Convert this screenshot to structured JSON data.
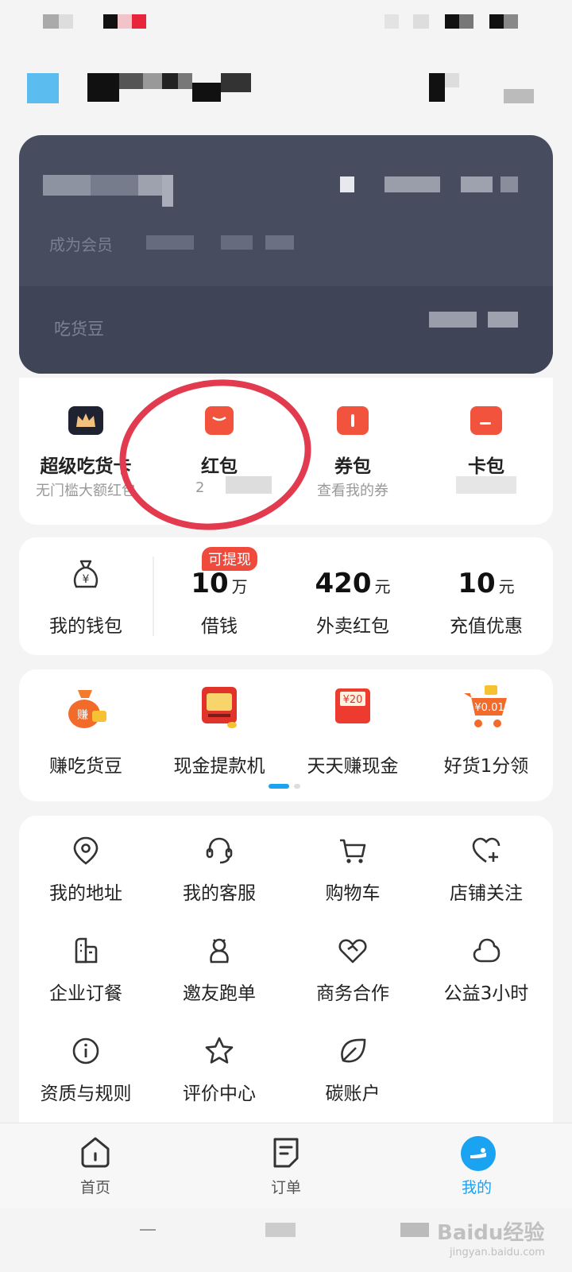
{
  "member_card": {
    "subtitle": "成为会员",
    "bean_label": "吃货豆"
  },
  "assets": [
    {
      "label": "超级吃货卡",
      "sub": "无门槛大额红包",
      "icon": "crown-card-icon",
      "color": "#1f2230"
    },
    {
      "label": "红包",
      "sub": "2",
      "icon": "red-envelope-icon",
      "color": "#f2533c"
    },
    {
      "label": "券包",
      "sub": "查看我的券",
      "icon": "coupon-icon",
      "color": "#f2533c"
    },
    {
      "label": "卡包",
      "sub": "",
      "icon": "card-wallet-icon",
      "color": "#f2533c"
    }
  ],
  "finance": {
    "wallet_label": "我的钱包",
    "badge": "可提现",
    "items": [
      {
        "value": "10",
        "unit": "万",
        "label": "借钱"
      },
      {
        "value": "420",
        "unit": "元",
        "label": "外卖红包"
      },
      {
        "value": "10",
        "unit": "元",
        "label": "充值优惠"
      }
    ]
  },
  "activities": [
    {
      "label": "赚吃货豆",
      "icon": "money-bag-icon",
      "badge": "赚"
    },
    {
      "label": "现金提款机",
      "icon": "atm-icon",
      "badge": ""
    },
    {
      "label": "天天赚现金",
      "icon": "cash-envelope-icon",
      "badge": "¥20"
    },
    {
      "label": "好货1分领",
      "icon": "shopping-cart-deal-icon",
      "badge": "¥0.01"
    }
  ],
  "services": [
    {
      "label": "我的地址",
      "icon": "location-pin-icon"
    },
    {
      "label": "我的客服",
      "icon": "headset-icon"
    },
    {
      "label": "购物车",
      "icon": "cart-icon"
    },
    {
      "label": "店铺关注",
      "icon": "heart-plus-icon"
    },
    {
      "label": "企业订餐",
      "icon": "building-icon"
    },
    {
      "label": "邀友跑单",
      "icon": "runner-icon"
    },
    {
      "label": "商务合作",
      "icon": "handshake-icon"
    },
    {
      "label": "公益3小时",
      "icon": "cloud-icon"
    },
    {
      "label": "资质与规则",
      "icon": "info-icon"
    },
    {
      "label": "评价中心",
      "icon": "star-icon"
    },
    {
      "label": "碳账户",
      "icon": "leaf-icon"
    }
  ],
  "nav": [
    {
      "label": "首页",
      "icon": "home-icon"
    },
    {
      "label": "订单",
      "icon": "order-icon"
    },
    {
      "label": "我的",
      "icon": "profile-icon"
    }
  ],
  "watermark": {
    "text": "Baidu经验",
    "sub": "jingyan.baidu.com"
  },
  "colors": {
    "accent": "#1aa3f0",
    "brand_red": "#f2533c",
    "badge_red": "#ef4a3c",
    "annotation": "#e23b4f",
    "card_bg": "#474d5f"
  }
}
